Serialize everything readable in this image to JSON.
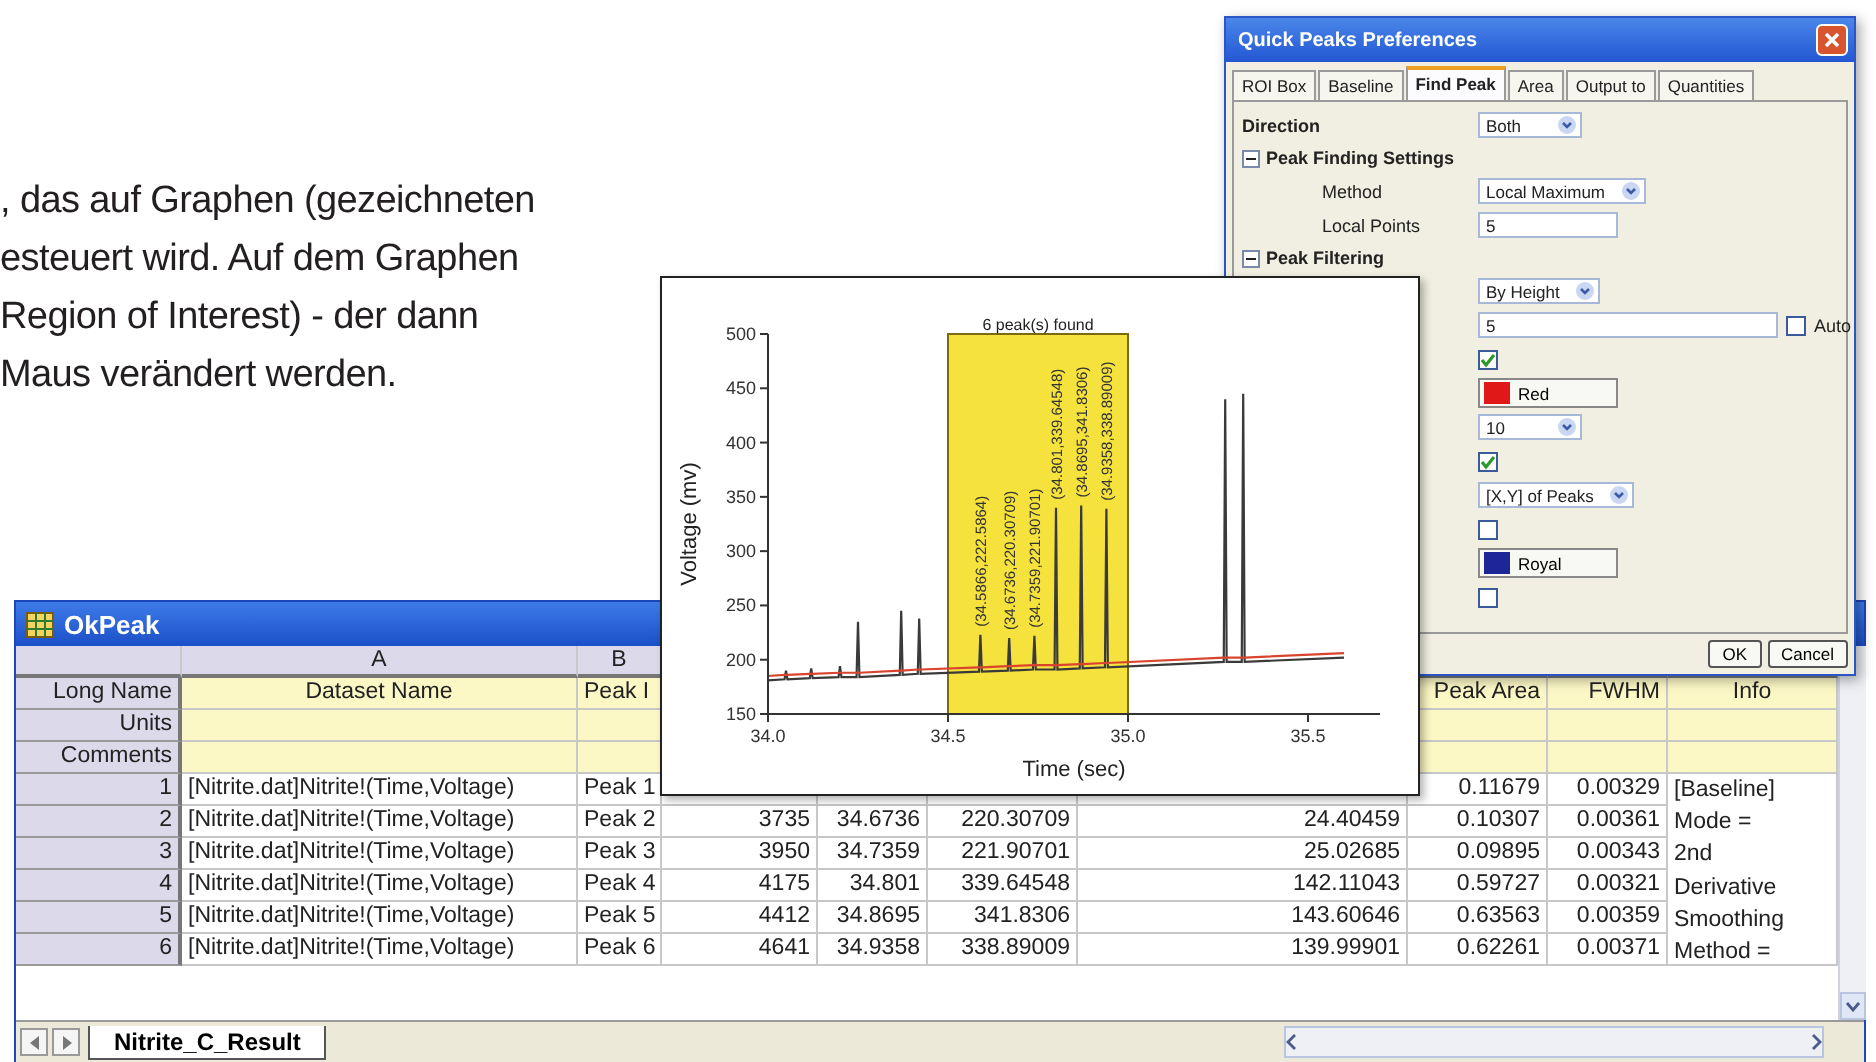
{
  "paragraph": {
    "lines": [
      ", das auf Graphen (gezeichneten",
      "esteuert wird. Auf dem Graphen",
      "Region of Interest) - der dann",
      "Maus verändert werden."
    ]
  },
  "worksheet": {
    "title": "OkPeak",
    "columns": [
      {
        "letter": "A",
        "long_name": "Dataset Name"
      },
      {
        "letter": "B",
        "long_name": "Peak I"
      },
      {},
      {},
      {},
      {},
      {
        "long_name": "Peak Area"
      },
      {
        "long_name": "FWHM"
      },
      {
        "long_name": "Info"
      }
    ],
    "header_rows": [
      "Long Name",
      "Units",
      "Comments"
    ],
    "rows": [
      {
        "index": "1",
        "cells": [
          "[Nitrite.dat]Nitrite!(Time,Voltage)",
          "Peak 1",
          null,
          null,
          null,
          null,
          "0.11679",
          "0.00329"
        ]
      },
      {
        "index": "2",
        "cells": [
          "[Nitrite.dat]Nitrite!(Time,Voltage)",
          "Peak 2",
          "3735",
          "34.6736",
          "220.30709",
          "24.40459",
          "0.10307",
          "0.00361"
        ]
      },
      {
        "index": "3",
        "cells": [
          "[Nitrite.dat]Nitrite!(Time,Voltage)",
          "Peak 3",
          "3950",
          "34.7359",
          "221.90701",
          "25.02685",
          "0.09895",
          "0.00343"
        ]
      },
      {
        "index": "4",
        "cells": [
          "[Nitrite.dat]Nitrite!(Time,Voltage)",
          "Peak 4",
          "4175",
          "34.801",
          "339.64548",
          "142.11043",
          "0.59727",
          "0.00321"
        ]
      },
      {
        "index": "5",
        "cells": [
          "[Nitrite.dat]Nitrite!(Time,Voltage)",
          "Peak 5",
          "4412",
          "34.8695",
          "341.8306",
          "143.60646",
          "0.63563",
          "0.00359"
        ]
      },
      {
        "index": "6",
        "cells": [
          "[Nitrite.dat]Nitrite!(Time,Voltage)",
          "Peak 6",
          "4641",
          "34.9358",
          "338.89009",
          "139.99901",
          "0.62261",
          "0.00371"
        ]
      }
    ],
    "info": "[Baseline] Mode = 2nd Derivative Smoothing Method =",
    "sheet_tabs": [
      {
        "label": "Nitrite_C_Result",
        "selected": true
      }
    ]
  },
  "dialog": {
    "title": "Quick Peaks Preferences",
    "tabs": [
      {
        "label": "ROI Box",
        "selected": false
      },
      {
        "label": "Baseline",
        "selected": false
      },
      {
        "label": "Find Peak",
        "selected": true
      },
      {
        "label": "Area",
        "selected": false
      },
      {
        "label": "Output to",
        "selected": false
      },
      {
        "label": "Quantities",
        "selected": false
      }
    ],
    "items": [
      {
        "kind": "dropdown",
        "label": "Direction",
        "value": "Both"
      },
      {
        "kind": "group",
        "label": "Peak Finding Settings",
        "expanded": true,
        "children": [
          {
            "kind": "dropdown",
            "label": "Method",
            "value": "Local Maximum"
          },
          {
            "kind": "text",
            "label": "Local Points",
            "value": "5"
          }
        ]
      },
      {
        "kind": "group",
        "label": "Peak Filtering",
        "expanded": true,
        "children": [
          {
            "kind": "dropdown",
            "value": "By Height"
          },
          {
            "kind": "text",
            "value": "5",
            "auto": {
              "label": "Auto",
              "checked": false
            }
          }
        ]
      },
      {
        "kind": "checkbox",
        "checked": true
      },
      {
        "kind": "color",
        "value": "Red",
        "color": "#e01818"
      },
      {
        "kind": "dropdown",
        "value": "10"
      },
      {
        "kind": "checkbox",
        "checked": true
      },
      {
        "kind": "dropdown",
        "value": "[X,Y] of Peaks"
      },
      {
        "kind": "checkbox",
        "checked": false
      },
      {
        "kind": "color",
        "value": "Royal",
        "color": "#1c2696"
      },
      {
        "kind": "checkbox",
        "checked": false
      }
    ],
    "buttons": [
      "OK",
      "Cancel"
    ]
  },
  "graph": {
    "chart_data": {
      "type": "line",
      "xlabel": "Time (sec)",
      "ylabel": "Voltage (mv)",
      "x": [
        34.0,
        34.046,
        34.05,
        34.054,
        34.116,
        34.12,
        34.124,
        34.196,
        34.2,
        34.204,
        34.246,
        34.25,
        34.254,
        34.366,
        34.37,
        34.374,
        34.416,
        34.42,
        34.424,
        34.586,
        34.59,
        34.594,
        34.666,
        34.67,
        34.674,
        34.736,
        34.74,
        34.744,
        34.796,
        34.8,
        34.804,
        34.866,
        34.87,
        34.874,
        34.936,
        34.94,
        34.944,
        35.266,
        35.27,
        35.274,
        35.316,
        35.32,
        35.324,
        35.6
      ],
      "series": [
        {
          "color": "#3a3a3a",
          "values": [
            181,
            182,
            190,
            182,
            183,
            192,
            183,
            184,
            194,
            184,
            184,
            235,
            184,
            186,
            245,
            186,
            187,
            238,
            187,
            189,
            223,
            189,
            190,
            220,
            190,
            191,
            222,
            191,
            191,
            340,
            191,
            192,
            342,
            192,
            193,
            339,
            193,
            198,
            440,
            198,
            198,
            445,
            198,
            202
          ]
        },
        {
          "color": "#d9442e",
          "values": [
            185,
            186,
            186,
            186,
            187,
            187,
            187,
            188,
            188,
            188,
            188,
            188,
            188,
            190,
            190,
            190,
            191,
            191,
            191,
            193,
            193,
            193,
            194,
            194,
            194,
            195,
            195,
            195,
            195,
            195,
            195,
            196,
            196,
            196,
            197,
            197,
            197,
            202,
            202,
            202,
            202,
            202,
            202,
            206
          ]
        }
      ],
      "xlim": [
        34.0,
        35.7
      ],
      "ylim": [
        150,
        500
      ],
      "xticks": [
        {
          "value": 34,
          "label": "34.0"
        },
        {
          "value": 34.5,
          "label": "34.5"
        },
        {
          "value": 35,
          "label": "35.0"
        },
        {
          "value": 35.5,
          "label": "35.5"
        }
      ],
      "yticks": [
        150,
        200,
        250,
        300,
        350,
        400,
        450,
        500
      ],
      "annotations": [
        {
          "text": "(34.5866,222.5864)",
          "x": 34.59,
          "y": 223
        },
        {
          "text": "(34.6736,220.30709)",
          "x": 34.67,
          "y": 220
        },
        {
          "text": "(34.7359,221.90701)",
          "x": 34.74,
          "y": 222
        },
        {
          "text": "(34.801,339.64548)",
          "x": 34.8,
          "y": 340
        },
        {
          "text": "(34.8695,341.8306)",
          "x": 34.87,
          "y": 342
        },
        {
          "text": "(34.9358,338.89009)",
          "x": 34.94,
          "y": 339
        }
      ]
    },
    "roi": {
      "caption": "6 peak(s) found"
    }
  }
}
